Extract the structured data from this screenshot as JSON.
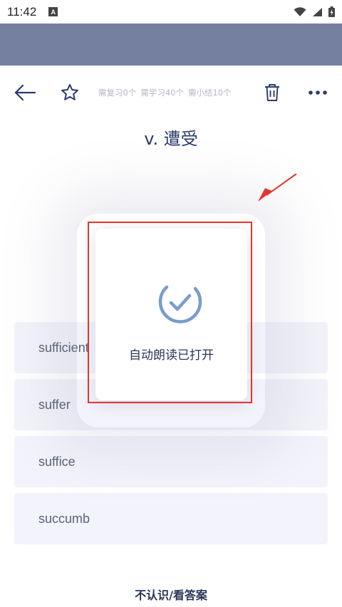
{
  "status_bar": {
    "time": "11:42",
    "notification_icon": "A"
  },
  "toolbar": {
    "back_icon": "arrow-left-icon",
    "star_icon": "star-outline-icon",
    "review_count": "需复习0个",
    "learn_count": "需学习40个",
    "summary_count": "需小结10个",
    "trash_icon": "trash-icon",
    "more_icon": "more-dots-icon"
  },
  "word": {
    "definition": "v. 遭受"
  },
  "options": [
    {
      "label": "sufficient"
    },
    {
      "label": "suffer"
    },
    {
      "label": "suffice"
    },
    {
      "label": "succumb"
    }
  ],
  "bottom": {
    "answer_link": "不认识/看答案"
  },
  "toast": {
    "message": "自动朗读已打开",
    "icon": "check-circle-icon"
  },
  "colors": {
    "header_band": "#7580a1",
    "accent": "#2b3a6b",
    "option_bg": "#f3f3fb",
    "highlight": "#e6352b",
    "check_icon": "#7a9ccc"
  }
}
